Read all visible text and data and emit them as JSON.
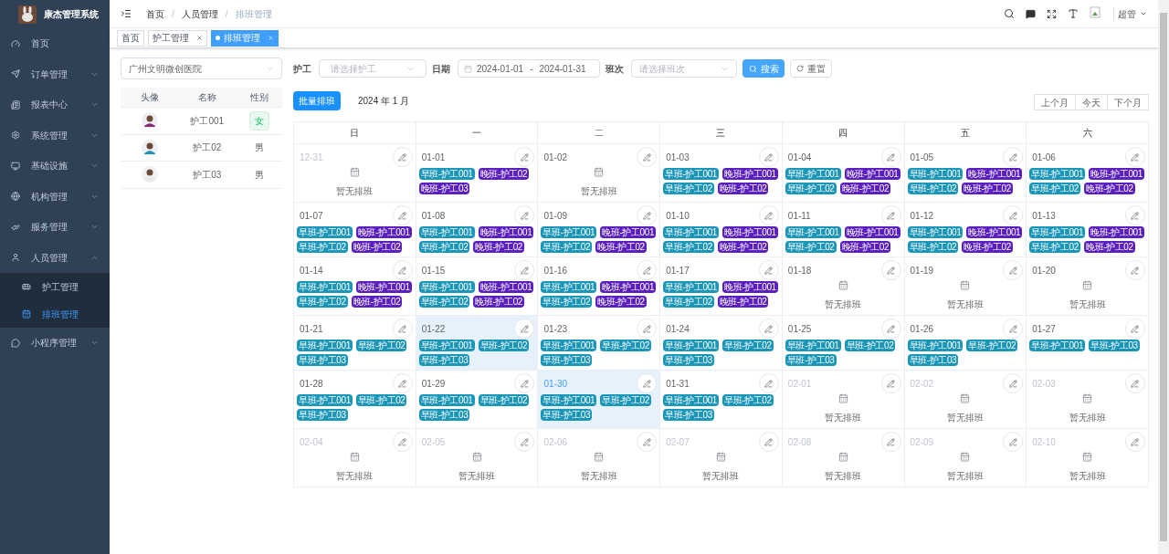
{
  "sidebar": {
    "title": "康杰管理系统",
    "items": [
      {
        "label": "首页",
        "kind": "link"
      },
      {
        "label": "订单管理",
        "kind": "group",
        "expanded": false
      },
      {
        "label": "报表中心",
        "kind": "group",
        "expanded": false
      },
      {
        "label": "系统管理",
        "kind": "group",
        "expanded": false
      },
      {
        "label": "基础设施",
        "kind": "group",
        "expanded": false
      },
      {
        "label": "机构管理",
        "kind": "group",
        "expanded": false
      },
      {
        "label": "服务管理",
        "kind": "group",
        "expanded": false
      },
      {
        "label": "人员管理",
        "kind": "group",
        "expanded": true,
        "children": [
          {
            "label": "护工管理",
            "selected": false
          },
          {
            "label": "排班管理",
            "selected": true
          }
        ]
      },
      {
        "label": "小程序管理",
        "kind": "group",
        "expanded": false
      }
    ]
  },
  "header": {
    "breadcrumb": [
      "首页",
      "人员管理",
      "排班管理"
    ],
    "breadcrumb_separator": "/",
    "user": "超管"
  },
  "tabs": [
    {
      "label": "首页",
      "selected": false,
      "closable": false
    },
    {
      "label": "护工管理",
      "selected": false,
      "closable": true
    },
    {
      "label": "排班管理",
      "selected": true,
      "closable": true
    }
  ],
  "hospital_select": {
    "value": "广州文明微创医院"
  },
  "staff_table": {
    "columns": [
      "头像",
      "名称",
      "性别"
    ],
    "rows": [
      {
        "name": "护工001",
        "gender": "女",
        "badge": true
      },
      {
        "name": "护工02",
        "gender": "男",
        "badge": false
      },
      {
        "name": "护工03",
        "gender": "男",
        "badge": false
      }
    ]
  },
  "filters": {
    "caregiver_label": "护工",
    "caregiver_placeholder": "请选择护工",
    "date_label": "日期",
    "date_start": "2024-01-01",
    "range_separator": "-",
    "date_end": "2024-01-31",
    "shift_label": "班次",
    "shift_placeholder": "请选择班次",
    "search_button": "搜索",
    "reset_button": "重置"
  },
  "toolbar": {
    "batch_button": "批量排班",
    "month": "2024 年 1 月",
    "nav_buttons": [
      "上个月",
      "今天",
      "下个月"
    ]
  },
  "calendar": {
    "weekdays": [
      "日",
      "一",
      "二",
      "三",
      "四",
      "五",
      "六"
    ],
    "days": [
      {
        "date": "12-31",
        "muted": true,
        "today": false,
        "selected": false,
        "empty_text": "暂无排班"
      },
      {
        "date": "01-01",
        "muted": false,
        "today": false,
        "selected": false,
        "shifts": [
          {
            "label": "早班-护工001",
            "kind": "morning"
          },
          {
            "label": "晚班-护工02",
            "kind": "evening"
          },
          {
            "label": "晚班-护工03",
            "kind": "evening"
          }
        ]
      },
      {
        "date": "01-02",
        "muted": false,
        "today": false,
        "selected": false,
        "empty_text": "暂无排班"
      },
      {
        "date": "01-03",
        "muted": false,
        "today": false,
        "selected": false,
        "shifts": [
          {
            "label": "早班-护工001",
            "kind": "morning"
          },
          {
            "label": "晚班-护工001",
            "kind": "evening"
          },
          {
            "label": "早班-护工02",
            "kind": "morning"
          },
          {
            "label": "晚班-护工02",
            "kind": "evening"
          }
        ]
      },
      {
        "date": "01-04",
        "muted": false,
        "today": false,
        "selected": false,
        "shifts": [
          {
            "label": "早班-护工001",
            "kind": "morning"
          },
          {
            "label": "晚班-护工001",
            "kind": "evening"
          },
          {
            "label": "早班-护工02",
            "kind": "morning"
          },
          {
            "label": "晚班-护工02",
            "kind": "evening"
          }
        ]
      },
      {
        "date": "01-05",
        "muted": false,
        "today": false,
        "selected": false,
        "shifts": [
          {
            "label": "早班-护工001",
            "kind": "morning"
          },
          {
            "label": "晚班-护工001",
            "kind": "evening"
          },
          {
            "label": "早班-护工02",
            "kind": "morning"
          },
          {
            "label": "晚班-护工02",
            "kind": "evening"
          }
        ]
      },
      {
        "date": "01-06",
        "muted": false,
        "today": false,
        "selected": false,
        "shifts": [
          {
            "label": "早班-护工001",
            "kind": "morning"
          },
          {
            "label": "晚班-护工001",
            "kind": "evening"
          },
          {
            "label": "早班-护工02",
            "kind": "morning"
          },
          {
            "label": "晚班-护工02",
            "kind": "evening"
          }
        ]
      },
      {
        "date": "01-07",
        "muted": false,
        "today": false,
        "selected": false,
        "shifts": [
          {
            "label": "早班-护工001",
            "kind": "morning"
          },
          {
            "label": "晚班-护工001",
            "kind": "evening"
          },
          {
            "label": "早班-护工02",
            "kind": "morning"
          },
          {
            "label": "晚班-护工02",
            "kind": "evening"
          }
        ]
      },
      {
        "date": "01-08",
        "muted": false,
        "today": false,
        "selected": false,
        "shifts": [
          {
            "label": "早班-护工001",
            "kind": "morning"
          },
          {
            "label": "晚班-护工001",
            "kind": "evening"
          },
          {
            "label": "早班-护工02",
            "kind": "morning"
          },
          {
            "label": "晚班-护工02",
            "kind": "evening"
          }
        ]
      },
      {
        "date": "01-09",
        "muted": false,
        "today": false,
        "selected": false,
        "shifts": [
          {
            "label": "早班-护工001",
            "kind": "morning"
          },
          {
            "label": "晚班-护工001",
            "kind": "evening"
          },
          {
            "label": "早班-护工02",
            "kind": "morning"
          },
          {
            "label": "晚班-护工02",
            "kind": "evening"
          }
        ]
      },
      {
        "date": "01-10",
        "muted": false,
        "today": false,
        "selected": false,
        "shifts": [
          {
            "label": "早班-护工001",
            "kind": "morning"
          },
          {
            "label": "晚班-护工001",
            "kind": "evening"
          },
          {
            "label": "早班-护工02",
            "kind": "morning"
          },
          {
            "label": "晚班-护工02",
            "kind": "evening"
          }
        ]
      },
      {
        "date": "01-11",
        "muted": false,
        "today": false,
        "selected": false,
        "shifts": [
          {
            "label": "早班-护工001",
            "kind": "morning"
          },
          {
            "label": "晚班-护工001",
            "kind": "evening"
          },
          {
            "label": "早班-护工02",
            "kind": "morning"
          },
          {
            "label": "晚班-护工02",
            "kind": "evening"
          }
        ]
      },
      {
        "date": "01-12",
        "muted": false,
        "today": false,
        "selected": false,
        "shifts": [
          {
            "label": "早班-护工001",
            "kind": "morning"
          },
          {
            "label": "晚班-护工001",
            "kind": "evening"
          },
          {
            "label": "早班-护工02",
            "kind": "morning"
          },
          {
            "label": "晚班-护工02",
            "kind": "evening"
          }
        ]
      },
      {
        "date": "01-13",
        "muted": false,
        "today": false,
        "selected": false,
        "shifts": [
          {
            "label": "早班-护工001",
            "kind": "morning"
          },
          {
            "label": "晚班-护工001",
            "kind": "evening"
          },
          {
            "label": "早班-护工02",
            "kind": "morning"
          },
          {
            "label": "晚班-护工02",
            "kind": "evening"
          }
        ]
      },
      {
        "date": "01-14",
        "muted": false,
        "today": false,
        "selected": false,
        "shifts": [
          {
            "label": "早班-护工001",
            "kind": "morning"
          },
          {
            "label": "晚班-护工001",
            "kind": "evening"
          },
          {
            "label": "早班-护工02",
            "kind": "morning"
          },
          {
            "label": "晚班-护工02",
            "kind": "evening"
          }
        ]
      },
      {
        "date": "01-15",
        "muted": false,
        "today": false,
        "selected": false,
        "shifts": [
          {
            "label": "早班-护工001",
            "kind": "morning"
          },
          {
            "label": "晚班-护工001",
            "kind": "evening"
          },
          {
            "label": "早班-护工02",
            "kind": "morning"
          },
          {
            "label": "晚班-护工02",
            "kind": "evening"
          }
        ]
      },
      {
        "date": "01-16",
        "muted": false,
        "today": false,
        "selected": false,
        "shifts": [
          {
            "label": "早班-护工001",
            "kind": "morning"
          },
          {
            "label": "晚班-护工001",
            "kind": "evening"
          },
          {
            "label": "早班-护工02",
            "kind": "morning"
          },
          {
            "label": "晚班-护工02",
            "kind": "evening"
          }
        ]
      },
      {
        "date": "01-17",
        "muted": false,
        "today": false,
        "selected": false,
        "shifts": [
          {
            "label": "早班-护工001",
            "kind": "morning"
          },
          {
            "label": "晚班-护工001",
            "kind": "evening"
          },
          {
            "label": "早班-护工02",
            "kind": "morning"
          },
          {
            "label": "晚班-护工02",
            "kind": "evening"
          }
        ]
      },
      {
        "date": "01-18",
        "muted": false,
        "today": false,
        "selected": false,
        "empty_text": "暂无排班"
      },
      {
        "date": "01-19",
        "muted": false,
        "today": false,
        "selected": false,
        "empty_text": "暂无排班"
      },
      {
        "date": "01-20",
        "muted": false,
        "today": false,
        "selected": false,
        "empty_text": "暂无排班"
      },
      {
        "date": "01-21",
        "muted": false,
        "today": false,
        "selected": false,
        "shifts": [
          {
            "label": "早班-护工001",
            "kind": "morning"
          },
          {
            "label": "早班-护工02",
            "kind": "morning"
          },
          {
            "label": "早班-护工03",
            "kind": "morning"
          }
        ]
      },
      {
        "date": "01-22",
        "muted": false,
        "today": false,
        "selected": true,
        "shifts": [
          {
            "label": "早班-护工001",
            "kind": "morning"
          },
          {
            "label": "早班-护工02",
            "kind": "morning"
          },
          {
            "label": "早班-护工03",
            "kind": "morning"
          }
        ]
      },
      {
        "date": "01-23",
        "muted": false,
        "today": false,
        "selected": false,
        "shifts": [
          {
            "label": "早班-护工001",
            "kind": "morning"
          },
          {
            "label": "早班-护工02",
            "kind": "morning"
          },
          {
            "label": "早班-护工03",
            "kind": "morning"
          }
        ]
      },
      {
        "date": "01-24",
        "muted": false,
        "today": false,
        "selected": false,
        "shifts": [
          {
            "label": "早班-护工001",
            "kind": "morning"
          },
          {
            "label": "早班-护工02",
            "kind": "morning"
          },
          {
            "label": "早班-护工03",
            "kind": "morning"
          }
        ]
      },
      {
        "date": "01-25",
        "muted": false,
        "today": false,
        "selected": false,
        "shifts": [
          {
            "label": "早班-护工001",
            "kind": "morning"
          },
          {
            "label": "早班-护工02",
            "kind": "morning"
          },
          {
            "label": "早班-护工03",
            "kind": "morning"
          }
        ]
      },
      {
        "date": "01-26",
        "muted": false,
        "today": false,
        "selected": false,
        "shifts": [
          {
            "label": "早班-护工001",
            "kind": "morning"
          },
          {
            "label": "早班-护工02",
            "kind": "morning"
          },
          {
            "label": "早班-护工03",
            "kind": "morning"
          }
        ]
      },
      {
        "date": "01-27",
        "muted": false,
        "today": false,
        "selected": false,
        "shifts": [
          {
            "label": "早班-护工001",
            "kind": "morning"
          },
          {
            "label": "早班-护工03",
            "kind": "morning"
          }
        ]
      },
      {
        "date": "01-28",
        "muted": false,
        "today": false,
        "selected": false,
        "shifts": [
          {
            "label": "早班-护工001",
            "kind": "morning"
          },
          {
            "label": "早班-护工02",
            "kind": "morning"
          },
          {
            "label": "早班-护工03",
            "kind": "morning"
          }
        ]
      },
      {
        "date": "01-29",
        "muted": false,
        "today": false,
        "selected": false,
        "shifts": [
          {
            "label": "早班-护工001",
            "kind": "morning"
          },
          {
            "label": "早班-护工02",
            "kind": "morning"
          },
          {
            "label": "早班-护工03",
            "kind": "morning"
          }
        ]
      },
      {
        "date": "01-30",
        "muted": false,
        "today": true,
        "selected": true,
        "shifts": [
          {
            "label": "早班-护工001",
            "kind": "morning"
          },
          {
            "label": "早班-护工02",
            "kind": "morning"
          },
          {
            "label": "早班-护工03",
            "kind": "morning"
          }
        ]
      },
      {
        "date": "01-31",
        "muted": false,
        "today": false,
        "selected": false,
        "shifts": [
          {
            "label": "早班-护工001",
            "kind": "morning"
          },
          {
            "label": "早班-护工02",
            "kind": "morning"
          },
          {
            "label": "早班-护工03",
            "kind": "morning"
          }
        ]
      },
      {
        "date": "02-01",
        "muted": true,
        "today": false,
        "selected": false,
        "empty_text": "暂无排班"
      },
      {
        "date": "02-02",
        "muted": true,
        "today": false,
        "selected": false,
        "empty_text": "暂无排班"
      },
      {
        "date": "02-03",
        "muted": true,
        "today": false,
        "selected": false,
        "empty_text": "暂无排班"
      },
      {
        "date": "02-04",
        "muted": true,
        "today": false,
        "selected": false,
        "empty_text": "暂无排班"
      },
      {
        "date": "02-05",
        "muted": true,
        "today": false,
        "selected": false,
        "empty_text": "暂无排班"
      },
      {
        "date": "02-06",
        "muted": true,
        "today": false,
        "selected": false,
        "empty_text": "暂无排班"
      },
      {
        "date": "02-07",
        "muted": true,
        "today": false,
        "selected": false,
        "empty_text": "暂无排班"
      },
      {
        "date": "02-08",
        "muted": true,
        "today": false,
        "selected": false,
        "empty_text": "暂无排班"
      },
      {
        "date": "02-09",
        "muted": true,
        "today": false,
        "selected": false,
        "empty_text": "暂无排班"
      },
      {
        "date": "02-10",
        "muted": true,
        "today": false,
        "selected": false,
        "empty_text": "暂无排班"
      }
    ]
  }
}
